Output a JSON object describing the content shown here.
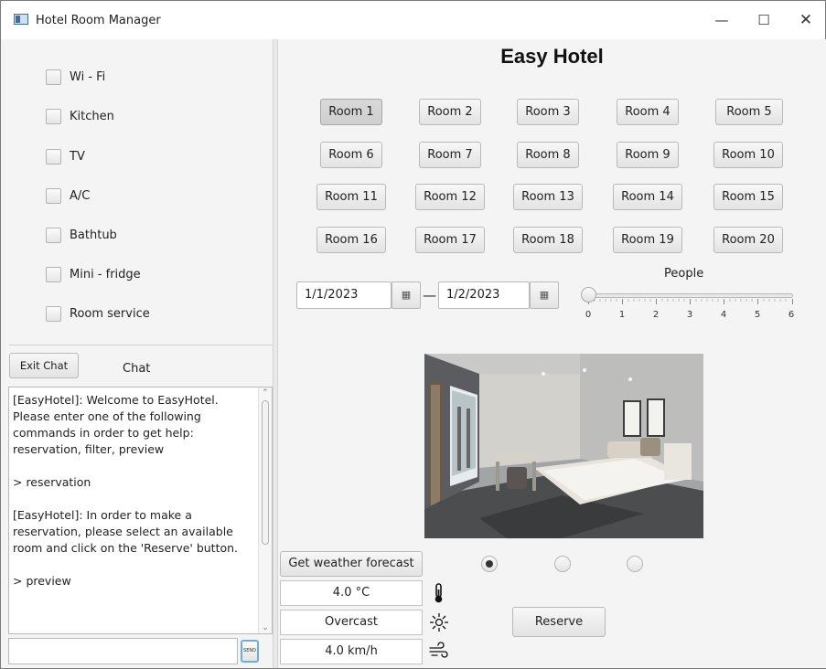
{
  "window": {
    "title": "Hotel Room Manager",
    "controls": {
      "minimize": "—",
      "maximize": "☐",
      "close": "✕"
    }
  },
  "filters": [
    {
      "label": "Wi - Fi",
      "checked": false
    },
    {
      "label": "Kitchen",
      "checked": false
    },
    {
      "label": "TV",
      "checked": false
    },
    {
      "label": "A/C",
      "checked": false
    },
    {
      "label": "Bathtub",
      "checked": false
    },
    {
      "label": "Mini - fridge",
      "checked": false
    },
    {
      "label": "Room service",
      "checked": false
    }
  ],
  "chat": {
    "exit_label": "Exit Chat",
    "title": "Chat",
    "messages": [
      "[EasyHotel]: Welcome to EasyHotel. Please enter one of the following commands in order to get help: reservation, filter, preview",
      "> reservation",
      "[EasyHotel]: In order to make a reservation, please select an available room and click on the 'Reserve' button.",
      "> preview"
    ],
    "input_value": "",
    "send_label": "SEND"
  },
  "main": {
    "title": "Easy Hotel",
    "rooms": [
      "Room 1",
      "Room 2",
      "Room 3",
      "Room 4",
      "Room 5",
      "Room 6",
      "Room 7",
      "Room 8",
      "Room 9",
      "Room 10",
      "Room 11",
      "Room 12",
      "Room 13",
      "Room 14",
      "Room 15",
      "Room 16",
      "Room 17",
      "Room 18",
      "Room 19",
      "Room 20"
    ],
    "selected_room": "Room 1",
    "check_in": "1/1/2023",
    "check_out": "1/2/2023",
    "people": {
      "label": "People",
      "ticks": [
        "0",
        "1",
        "2",
        "3",
        "4",
        "5",
        "6"
      ],
      "value": 0
    },
    "preview_selected": 0,
    "weather": {
      "button": "Get weather forecast",
      "temperature": "4.0 °C",
      "condition": "Overcast",
      "wind": "4.0 km/h"
    },
    "reserve_label": "Reserve"
  }
}
